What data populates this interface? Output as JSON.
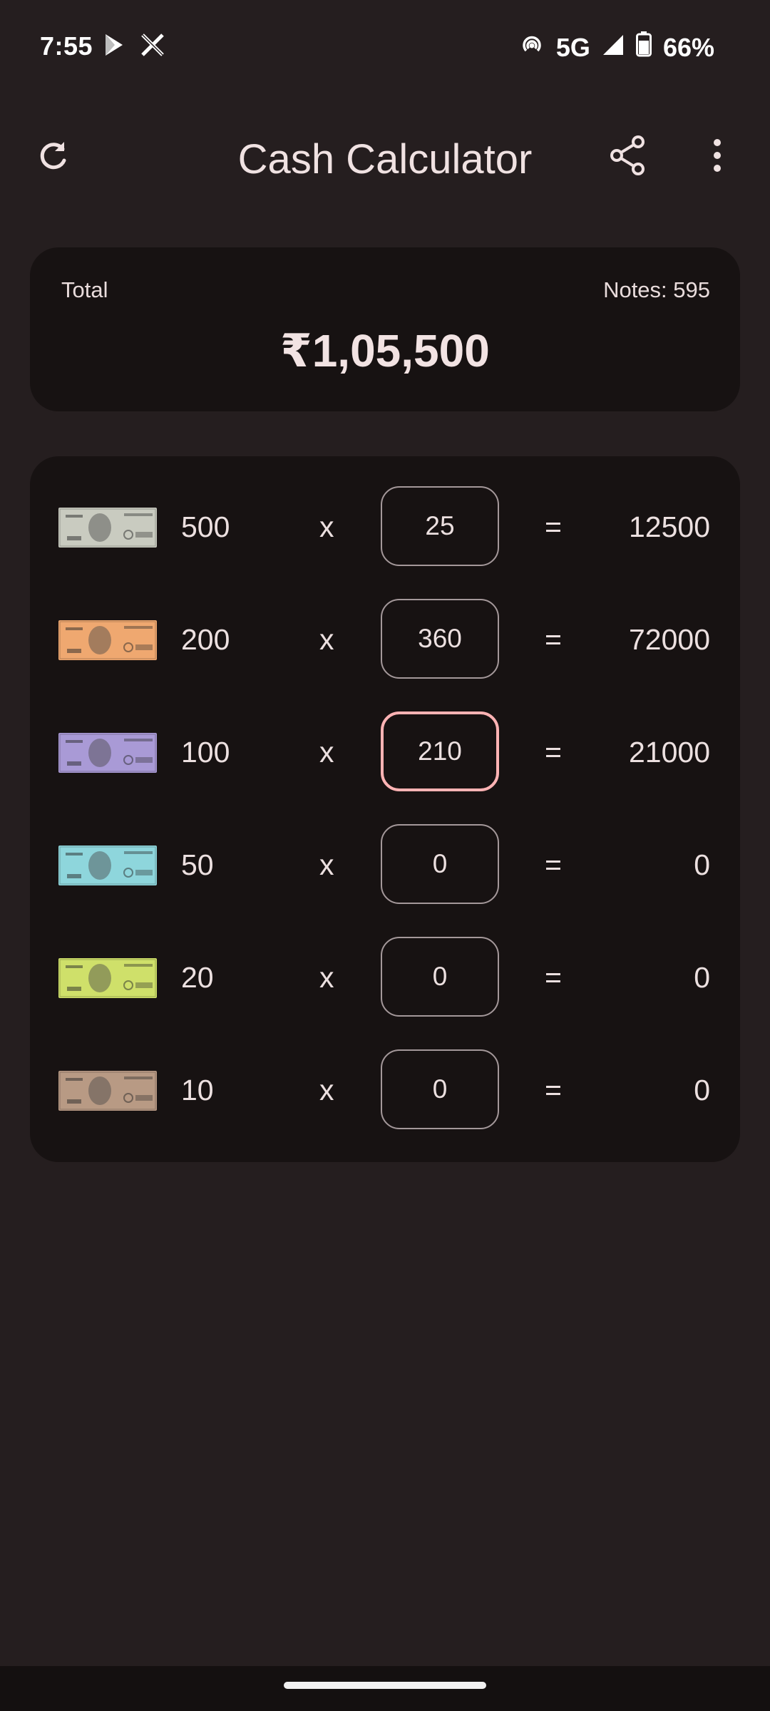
{
  "status_bar": {
    "time": "7:55",
    "network": "5G",
    "battery": "66%",
    "icons": [
      "play-store-icon",
      "x-icon",
      "hotspot-icon",
      "signal-icon",
      "battery-icon"
    ]
  },
  "app_bar": {
    "title": "Cash Calculator",
    "icons": [
      "refresh-icon",
      "share-icon",
      "more-vert-icon"
    ]
  },
  "summary": {
    "total_label": "Total",
    "notes_label": "Notes: 595",
    "total_value": "₹1,05,500"
  },
  "operators": {
    "times": "x",
    "equals": "="
  },
  "rows": [
    {
      "denomination": "500",
      "count": "25",
      "amount": "12500",
      "note_color": "#c9cbc0",
      "focused": false
    },
    {
      "denomination": "200",
      "count": "360",
      "amount": "72000",
      "note_color": "#efa870",
      "focused": false
    },
    {
      "denomination": "100",
      "count": "210",
      "amount": "21000",
      "note_color": "#a99ad6",
      "focused": true
    },
    {
      "denomination": "50",
      "count": "0",
      "amount": "0",
      "note_color": "#8ed6dc",
      "focused": false
    },
    {
      "denomination": "20",
      "count": "0",
      "amount": "0",
      "note_color": "#cfe06a",
      "focused": false
    },
    {
      "denomination": "10",
      "count": "0",
      "amount": "0",
      "note_color": "#b89a84",
      "focused": false
    }
  ],
  "colors": {
    "background": "#251e1f",
    "card": "#171212",
    "focus_border": "#ffb3b4",
    "input_border": "#a4989a"
  }
}
